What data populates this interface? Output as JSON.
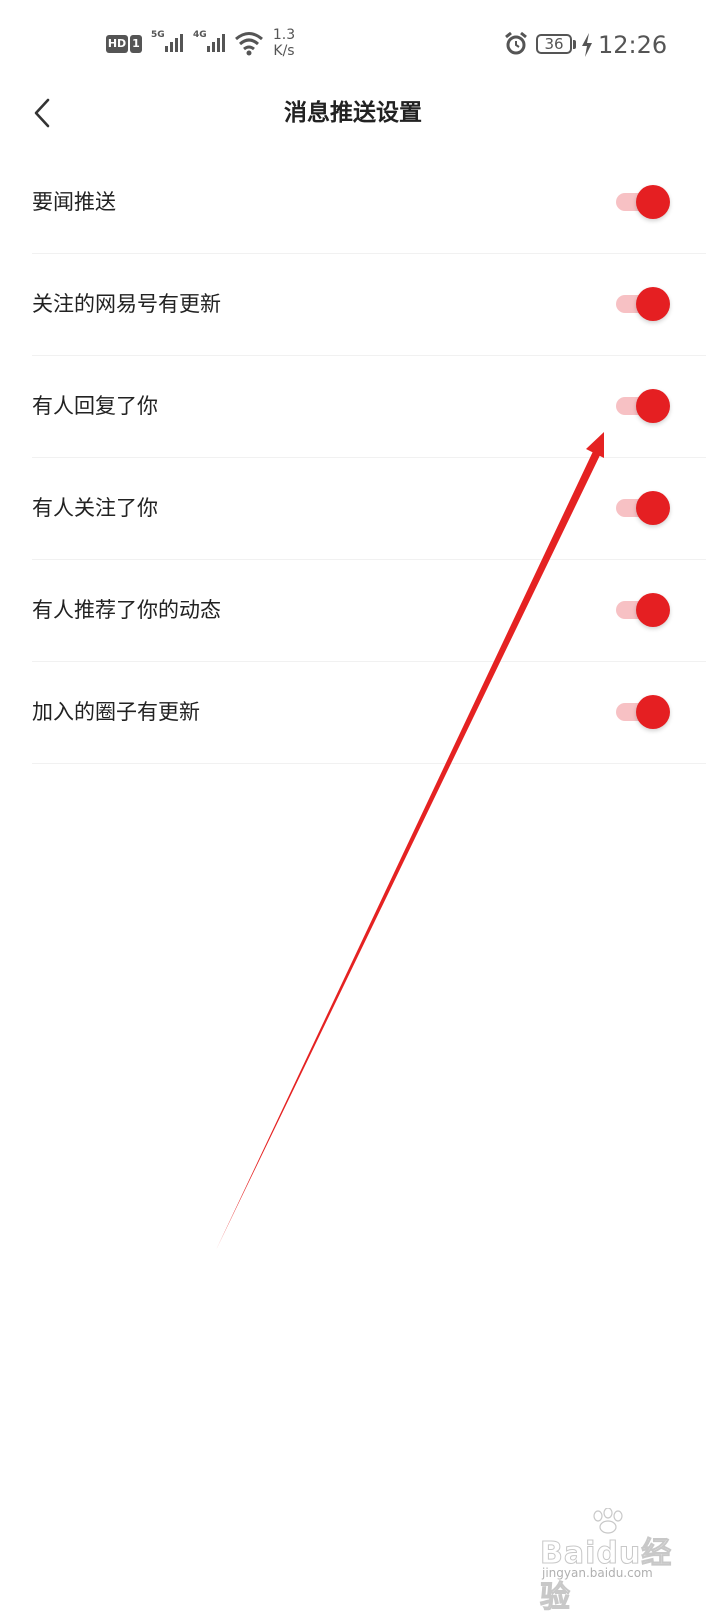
{
  "status_bar": {
    "hd_label": "HD",
    "sim_label": "1",
    "network_1": "5G",
    "network_2": "4G",
    "speed_value": "1.3",
    "speed_unit": "K/s",
    "battery": "36",
    "time": "12:26",
    "icons": [
      "hd-icon",
      "sim-icon",
      "signal-icon",
      "wifi-icon",
      "alarm-icon",
      "battery-icon",
      "charging-icon"
    ]
  },
  "header": {
    "title": "消息推送设置",
    "back_icon": "chevron-left-icon"
  },
  "settings": [
    {
      "label": "要闻推送",
      "enabled": true
    },
    {
      "label": "关注的网易号有更新",
      "enabled": true
    },
    {
      "label": "有人回复了你",
      "enabled": true
    },
    {
      "label": "有人关注了你",
      "enabled": true
    },
    {
      "label": "有人推荐了你的动态",
      "enabled": true
    },
    {
      "label": "加入的圈子有更新",
      "enabled": true
    }
  ],
  "colors": {
    "accent": "#e51f22",
    "track_on": "#f7c1c4",
    "annotation": "#e52222"
  },
  "watermark": {
    "main": "Baidu经验",
    "sub": "jingyan.baidu.com"
  }
}
